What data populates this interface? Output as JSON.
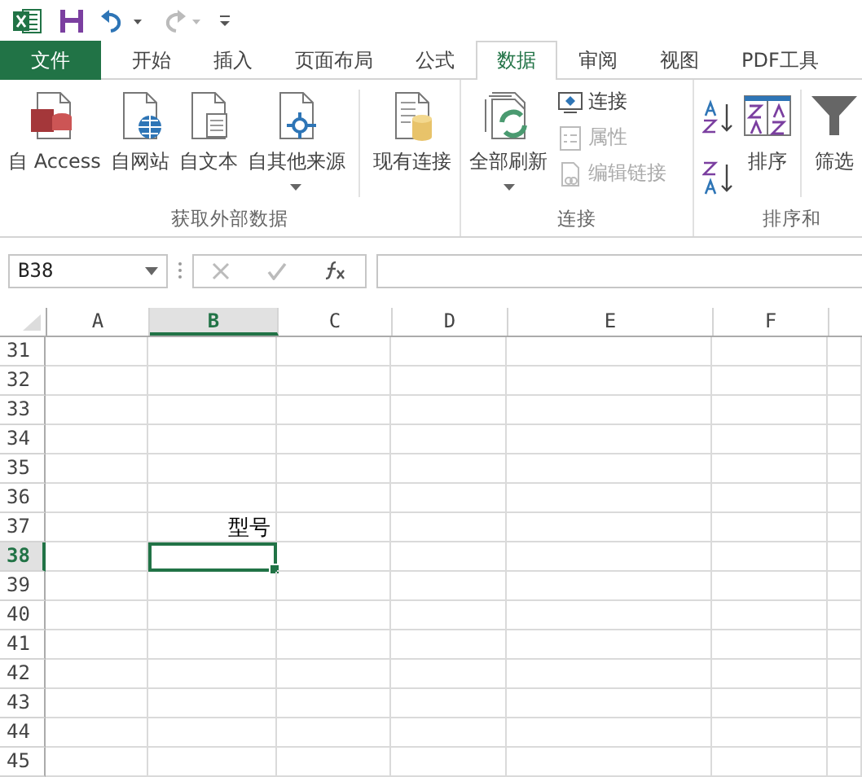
{
  "tabs": [
    {
      "label": "文件",
      "kind": "file",
      "selected": false
    },
    {
      "label": "开始",
      "kind": "normal",
      "selected": false
    },
    {
      "label": "插入",
      "kind": "normal",
      "selected": false
    },
    {
      "label": "页面布局",
      "kind": "normal",
      "selected": false
    },
    {
      "label": "公式",
      "kind": "normal",
      "selected": false
    },
    {
      "label": "数据",
      "kind": "normal",
      "selected": true
    },
    {
      "label": "审阅",
      "kind": "normal",
      "selected": false
    },
    {
      "label": "视图",
      "kind": "normal",
      "selected": false
    },
    {
      "label": "PDF工具",
      "kind": "normal",
      "selected": false
    }
  ],
  "ribbon": {
    "groups": [
      {
        "label": "获取外部数据",
        "items": [
          {
            "kind": "large",
            "label": "自 Access",
            "dropdown": false
          },
          {
            "kind": "large",
            "label": "自网站",
            "dropdown": false
          },
          {
            "kind": "large",
            "label": "自文本",
            "dropdown": false
          },
          {
            "kind": "large",
            "label": "自其他来源",
            "dropdown": true
          },
          {
            "kind": "separator"
          },
          {
            "kind": "large",
            "label": "现有连接",
            "dropdown": false
          }
        ]
      },
      {
        "label": "连接",
        "items": [
          {
            "kind": "large",
            "label": "全部刷新",
            "dropdown": true
          },
          {
            "kind": "small",
            "label": "连接",
            "disabled": false
          },
          {
            "kind": "small",
            "label": "属性",
            "disabled": true
          },
          {
            "kind": "small",
            "label": "编辑链接",
            "disabled": true
          }
        ]
      },
      {
        "label": "排序和",
        "items": [
          {
            "kind": "icon"
          },
          {
            "kind": "icon"
          },
          {
            "kind": "large",
            "label": "排序",
            "dropdown": false
          },
          {
            "kind": "separator"
          },
          {
            "kind": "large",
            "label": "筛选",
            "dropdown": false
          }
        ]
      }
    ]
  },
  "formula_bar": {
    "name_box": "B38"
  },
  "sheet": {
    "columns": [
      {
        "label": "A",
        "selected": false
      },
      {
        "label": "B",
        "selected": true
      },
      {
        "label": "C",
        "selected": false
      },
      {
        "label": "D",
        "selected": false
      },
      {
        "label": "E",
        "selected": false
      },
      {
        "label": "F",
        "selected": false
      }
    ],
    "rows": [
      {
        "number": "31",
        "selected": false
      },
      {
        "number": "32",
        "selected": false
      },
      {
        "number": "33",
        "selected": false
      },
      {
        "number": "34",
        "selected": false
      },
      {
        "number": "35",
        "selected": false
      },
      {
        "number": "36",
        "selected": false
      },
      {
        "number": "37",
        "selected": false,
        "column_b": "型号"
      },
      {
        "number": "38",
        "selected": true
      },
      {
        "number": "39",
        "selected": false
      },
      {
        "number": "40",
        "selected": false
      },
      {
        "number": "41",
        "selected": false
      },
      {
        "number": "42",
        "selected": false
      },
      {
        "number": "43",
        "selected": false
      },
      {
        "number": "44",
        "selected": false
      },
      {
        "number": "45",
        "selected": false
      }
    ]
  }
}
